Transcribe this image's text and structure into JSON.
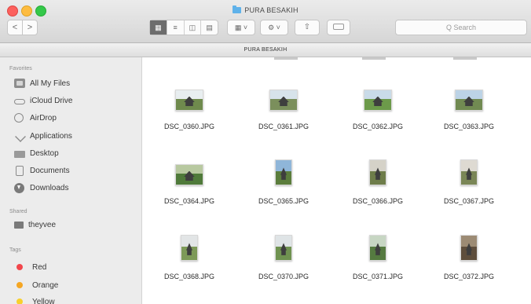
{
  "window": {
    "title": "PURA BESAKIH",
    "path_bar": "PURA BESAKIH"
  },
  "toolbar": {
    "back_icon": "<",
    "forward_icon": ">",
    "view_modes": [
      "icon-view",
      "list-view",
      "column-view",
      "coverflow-view"
    ],
    "search_placeholder": "Q Search"
  },
  "sidebar": {
    "favorites_header": "Favorites",
    "favorites": [
      {
        "label": "All My Files",
        "icon": "all-files-icon"
      },
      {
        "label": "iCloud Drive",
        "icon": "cloud-icon"
      },
      {
        "label": "AirDrop",
        "icon": "airdrop-icon"
      },
      {
        "label": "Applications",
        "icon": "applications-icon"
      },
      {
        "label": "Desktop",
        "icon": "desktop-icon"
      },
      {
        "label": "Documents",
        "icon": "documents-icon"
      },
      {
        "label": "Downloads",
        "icon": "downloads-icon"
      }
    ],
    "shared_header": "Shared",
    "shared": [
      {
        "label": "theyvee",
        "icon": "computer-icon"
      }
    ],
    "tags_header": "Tags",
    "tags": [
      {
        "label": "Red",
        "color": "#f2464b"
      },
      {
        "label": "Orange",
        "color": "#f5a623"
      },
      {
        "label": "Yellow",
        "color": "#f8d02e"
      }
    ]
  },
  "files": [
    {
      "name": "DSC_0360.JPG",
      "orient": "land",
      "sky": "#e8eef0",
      "ground": "#6f8a4d"
    },
    {
      "name": "DSC_0361.JPG",
      "orient": "land",
      "sky": "#d7e3ea",
      "ground": "#7b8f5c"
    },
    {
      "name": "DSC_0362.JPG",
      "orient": "land",
      "sky": "#c9dbe8",
      "ground": "#6c9a4a"
    },
    {
      "name": "DSC_0363.JPG",
      "orient": "land",
      "sky": "#bcd3e6",
      "ground": "#718a52"
    },
    {
      "name": "DSC_0364.JPG",
      "orient": "land",
      "sky": "#b8c9a0",
      "ground": "#4f7a3a"
    },
    {
      "name": "DSC_0365.JPG",
      "orient": "port",
      "sky": "#8fb6d9",
      "ground": "#5b7d3c"
    },
    {
      "name": "DSC_0366.JPG",
      "orient": "port",
      "sky": "#d5d2c8",
      "ground": "#6e7d4a"
    },
    {
      "name": "DSC_0367.JPG",
      "orient": "port",
      "sky": "#dedad2",
      "ground": "#7a8656"
    },
    {
      "name": "DSC_0368.JPG",
      "orient": "port",
      "sky": "#e2e5e6",
      "ground": "#7d9a58"
    },
    {
      "name": "DSC_0370.JPG",
      "orient": "port",
      "sky": "#dfe4e6",
      "ground": "#6f9250"
    },
    {
      "name": "DSC_0371.JPG",
      "orient": "port",
      "sky": "#c7d6c3",
      "ground": "#557a40"
    },
    {
      "name": "DSC_0372.JPG",
      "orient": "port",
      "sky": "#9c8b74",
      "ground": "#5e4e3c"
    }
  ]
}
